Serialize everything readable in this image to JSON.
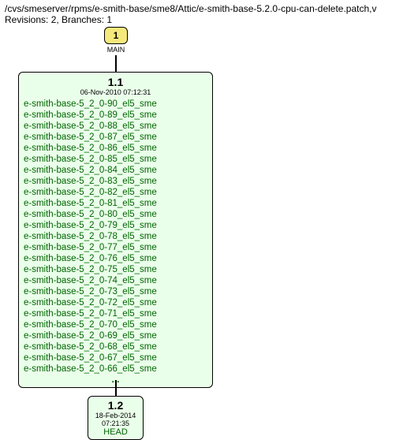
{
  "header": {
    "path": "/cvs/smeserver/rpms/e-smith-base/sme8/Attic/e-smith-base-5.2.0-cpu-can-delete.patch,v",
    "revinfo": "Revisions: 2, Branches: 1"
  },
  "diagram": {
    "main": {
      "index": "1",
      "label": "MAIN"
    },
    "rev11": {
      "title": "1.1",
      "date": "06-Nov-2010 07:12:31",
      "tags": [
        "e-smith-base-5_2_0-90_el5_sme",
        "e-smith-base-5_2_0-89_el5_sme",
        "e-smith-base-5_2_0-88_el5_sme",
        "e-smith-base-5_2_0-87_el5_sme",
        "e-smith-base-5_2_0-86_el5_sme",
        "e-smith-base-5_2_0-85_el5_sme",
        "e-smith-base-5_2_0-84_el5_sme",
        "e-smith-base-5_2_0-83_el5_sme",
        "e-smith-base-5_2_0-82_el5_sme",
        "e-smith-base-5_2_0-81_el5_sme",
        "e-smith-base-5_2_0-80_el5_sme",
        "e-smith-base-5_2_0-79_el5_sme",
        "e-smith-base-5_2_0-78_el5_sme",
        "e-smith-base-5_2_0-77_el5_sme",
        "e-smith-base-5_2_0-76_el5_sme",
        "e-smith-base-5_2_0-75_el5_sme",
        "e-smith-base-5_2_0-74_el5_sme",
        "e-smith-base-5_2_0-73_el5_sme",
        "e-smith-base-5_2_0-72_el5_sme",
        "e-smith-base-5_2_0-71_el5_sme",
        "e-smith-base-5_2_0-70_el5_sme",
        "e-smith-base-5_2_0-69_el5_sme",
        "e-smith-base-5_2_0-68_el5_sme",
        "e-smith-base-5_2_0-67_el5_sme",
        "e-smith-base-5_2_0-66_el5_sme"
      ],
      "ellipsis": "..."
    },
    "rev12": {
      "title": "1.2",
      "date": "18-Feb-2014 07:21:35",
      "head": "HEAD"
    }
  }
}
